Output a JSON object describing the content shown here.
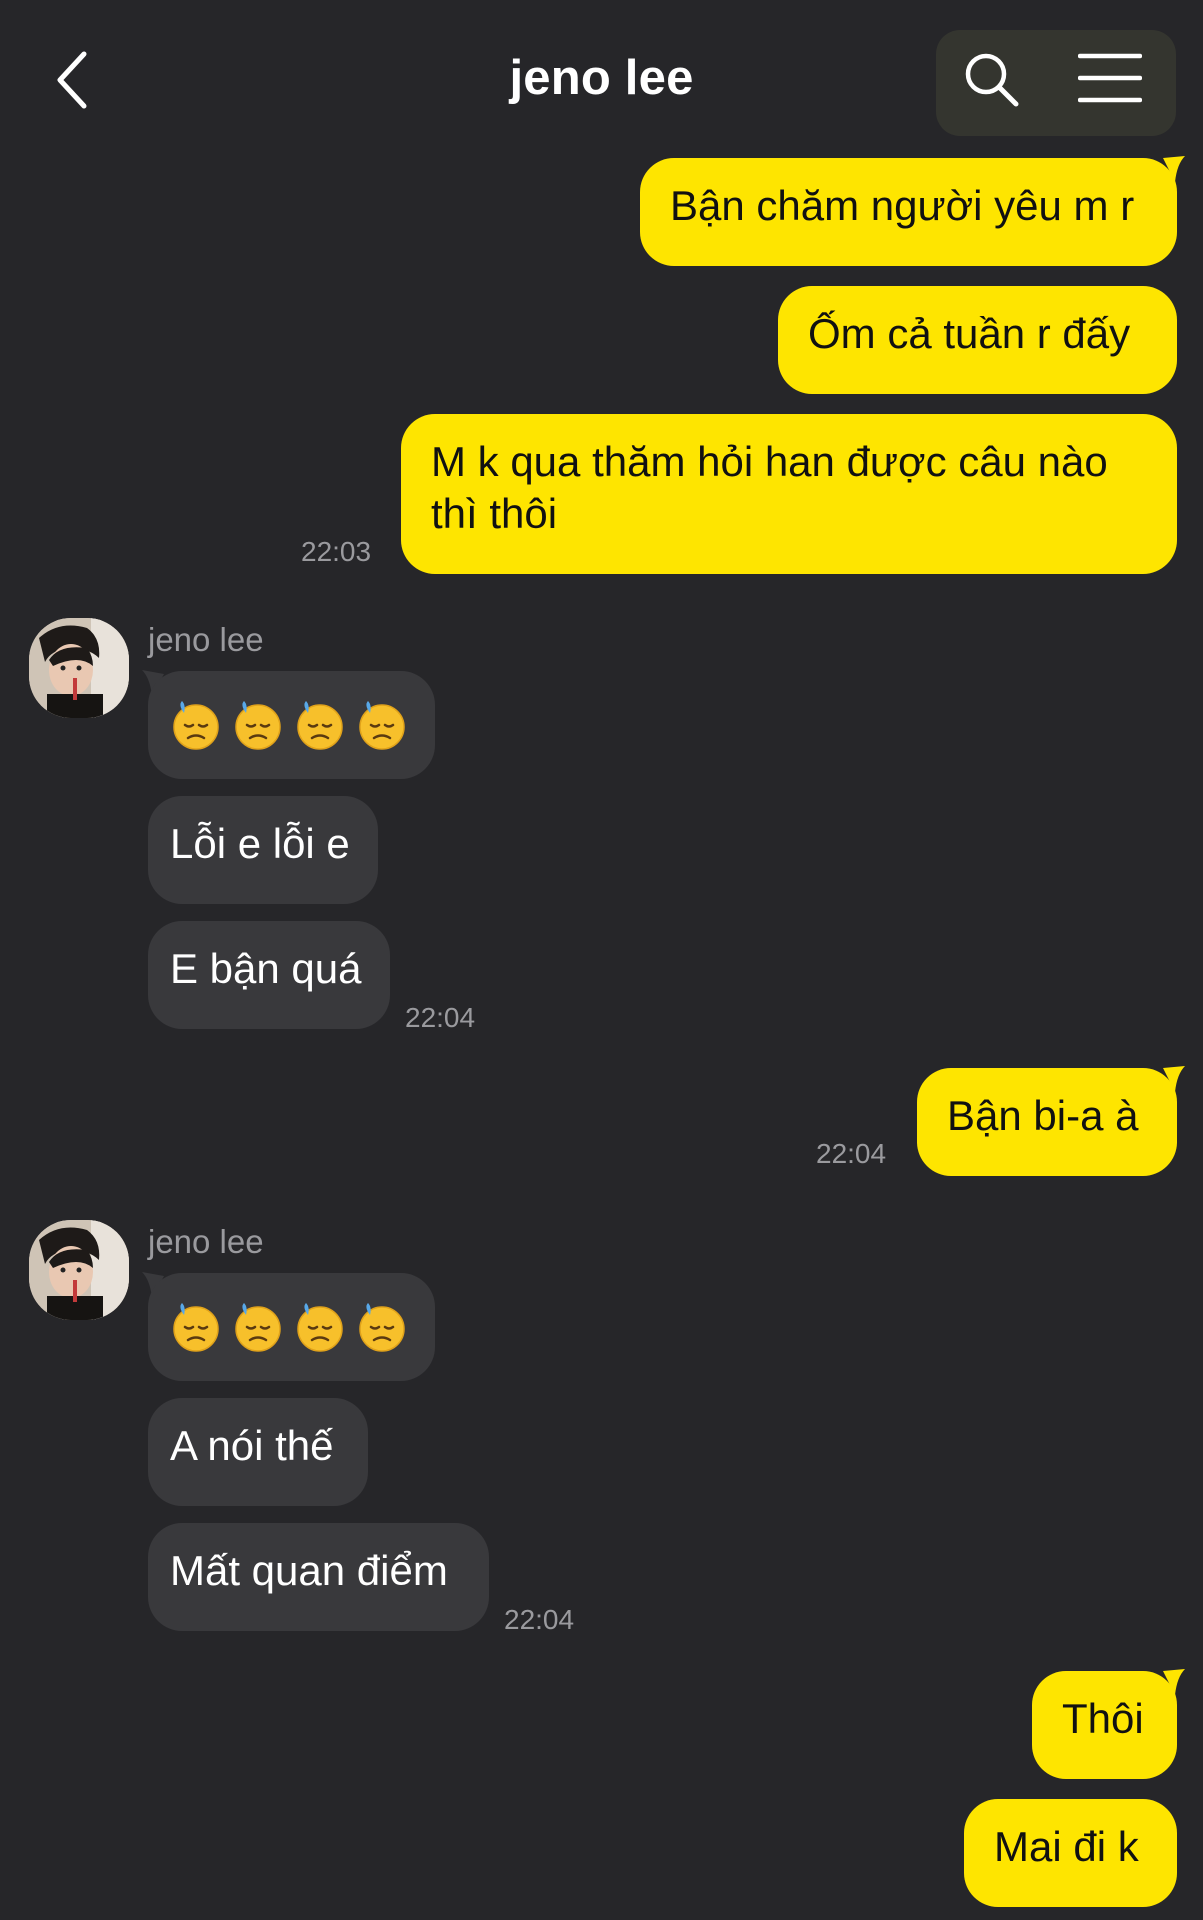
{
  "header": {
    "title": "jeno lee",
    "back_icon": "chevron-left-icon",
    "search_icon": "search-icon",
    "menu_icon": "hamburger-menu-icon"
  },
  "colors": {
    "background": "#262629",
    "outgoing_bubble": "#fee500",
    "incoming_bubble": "#39393c",
    "timestamp": "#9a9a9e"
  },
  "messages": {
    "out1": "Bận chăm người yêu m r",
    "out2": "Ốm cả tuần r đấy",
    "out3_line1": "M k qua thăm hỏi han được câu nào",
    "out3_line2": "thì thôi",
    "time1": "22:03",
    "sender1": "jeno lee",
    "in1_emoji": "downcast-face-with-sweat-emoji x4",
    "in2": "Lỗi e lỗi e",
    "in3": "E bận quá",
    "time2": "22:04",
    "out4": "Bận bi-a à",
    "time3": "22:04",
    "sender2": "jeno lee",
    "in4_emoji": "downcast-face-with-sweat-emoji x4",
    "in5": "A nói thế",
    "in6": "Mất quan điểm",
    "time4": "22:04",
    "out5": "Thôi",
    "out6": "Mai đi k"
  }
}
